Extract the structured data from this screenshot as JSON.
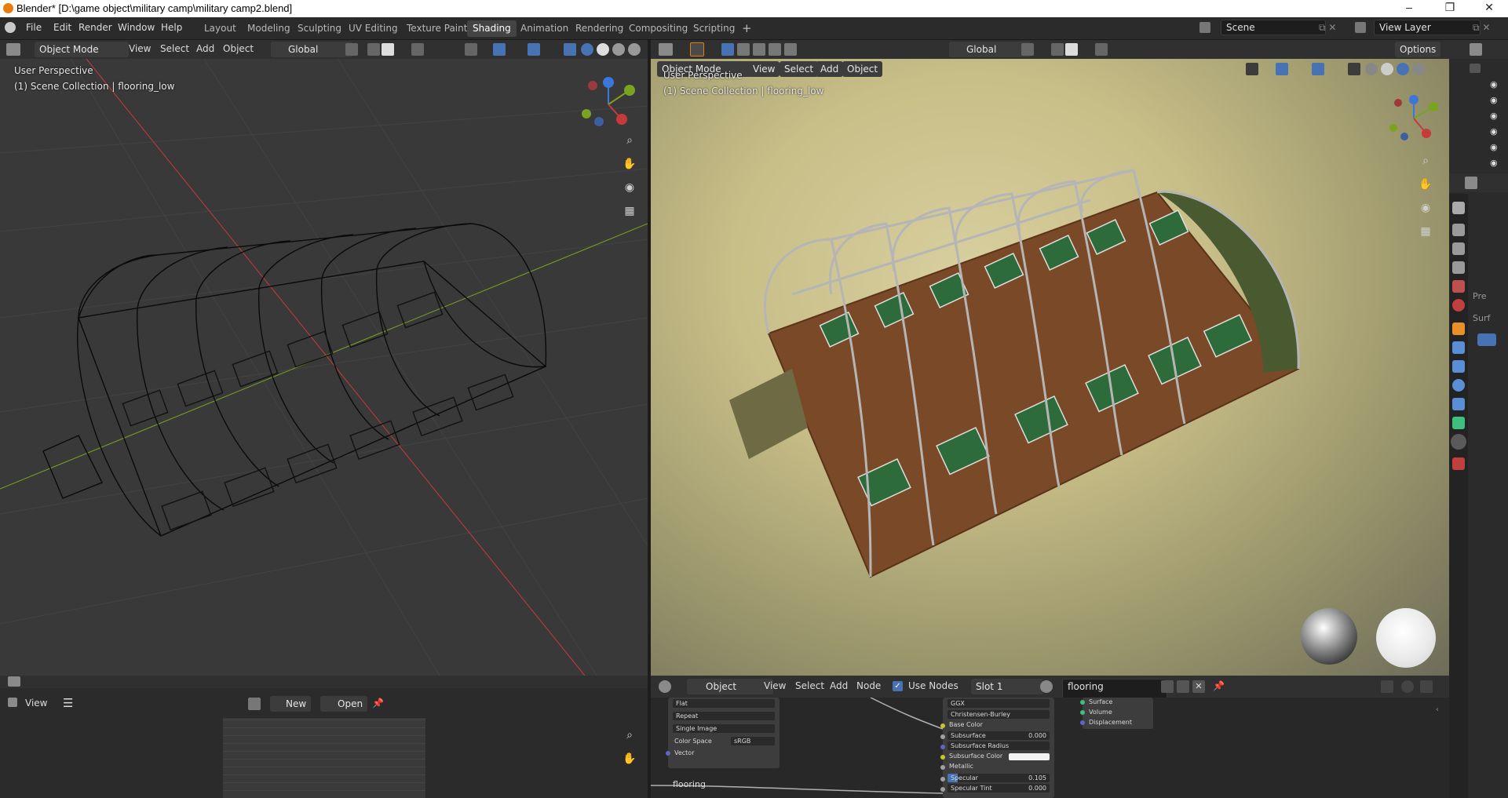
{
  "window": {
    "title": "Blender* [D:\\game object\\military camp\\military camp2.blend]",
    "controls": {
      "minimize": "–",
      "restore": "❐",
      "close": "✕"
    }
  },
  "menu": [
    "File",
    "Edit",
    "Render",
    "Window",
    "Help"
  ],
  "workspaces": {
    "tabs": [
      "Layout",
      "Modeling",
      "Sculpting",
      "UV Editing",
      "Texture Paint",
      "Shading",
      "Animation",
      "Rendering",
      "Compositing",
      "Scripting"
    ],
    "active": "Shading",
    "add": "+"
  },
  "scene": {
    "name": "Scene",
    "view_layer": "View Layer"
  },
  "left_viewport": {
    "mode": "Object Mode",
    "menus": [
      "View",
      "Select",
      "Add",
      "Object"
    ],
    "orientation": "Global",
    "perspective_label": "User Perspective",
    "collection_label": "(1) Scene Collection | flooring_low",
    "shading": "wireframe"
  },
  "right_viewport": {
    "mode": "Object Mode",
    "menus": [
      "View",
      "Select",
      "Add",
      "Object"
    ],
    "orientation": "Global",
    "options": "Options",
    "perspective_label": "User Perspective",
    "collection_label": "(1) Scene Collection | flooring_low",
    "shading": "material-preview"
  },
  "image_editor": {
    "view": "View",
    "new": "New",
    "open": "Open"
  },
  "node_editor": {
    "type": "Object",
    "menus": [
      "View",
      "Select",
      "Add",
      "Node"
    ],
    "use_nodes_label": "Use Nodes",
    "use_nodes": true,
    "slot": "Slot 1",
    "material": "flooring",
    "image_node": {
      "rows": [
        "Flat",
        "Repeat",
        "Single Image"
      ],
      "color_space_label": "Color Space",
      "color_space": "sRGB",
      "vector": "Vector",
      "name": "flooring"
    },
    "bsdf_node": {
      "distribution": "GGX",
      "subsurface_method": "Christensen-Burley",
      "base_color": "Base Color",
      "subsurface": "Subsurface",
      "subsurface_value": "0.000",
      "subsurface_radius": "Subsurface Radius",
      "subsurface_color": "Subsurface Color",
      "metallic": "Metallic",
      "specular": "Specular",
      "specular_value": "0.105",
      "specular_tint": "Specular Tint",
      "specular_tint_value": "0.000"
    },
    "output_node": {
      "inputs": [
        "Surface",
        "Volume",
        "Displacement"
      ]
    }
  },
  "properties": {
    "partial_labels": [
      "Pre",
      "Surf"
    ]
  },
  "colors": {
    "accent": "#4772b3",
    "active_tab": "#444444",
    "x_axis": "#c83a3a",
    "y_axis": "#7aa321",
    "z_axis": "#3b76d9"
  }
}
